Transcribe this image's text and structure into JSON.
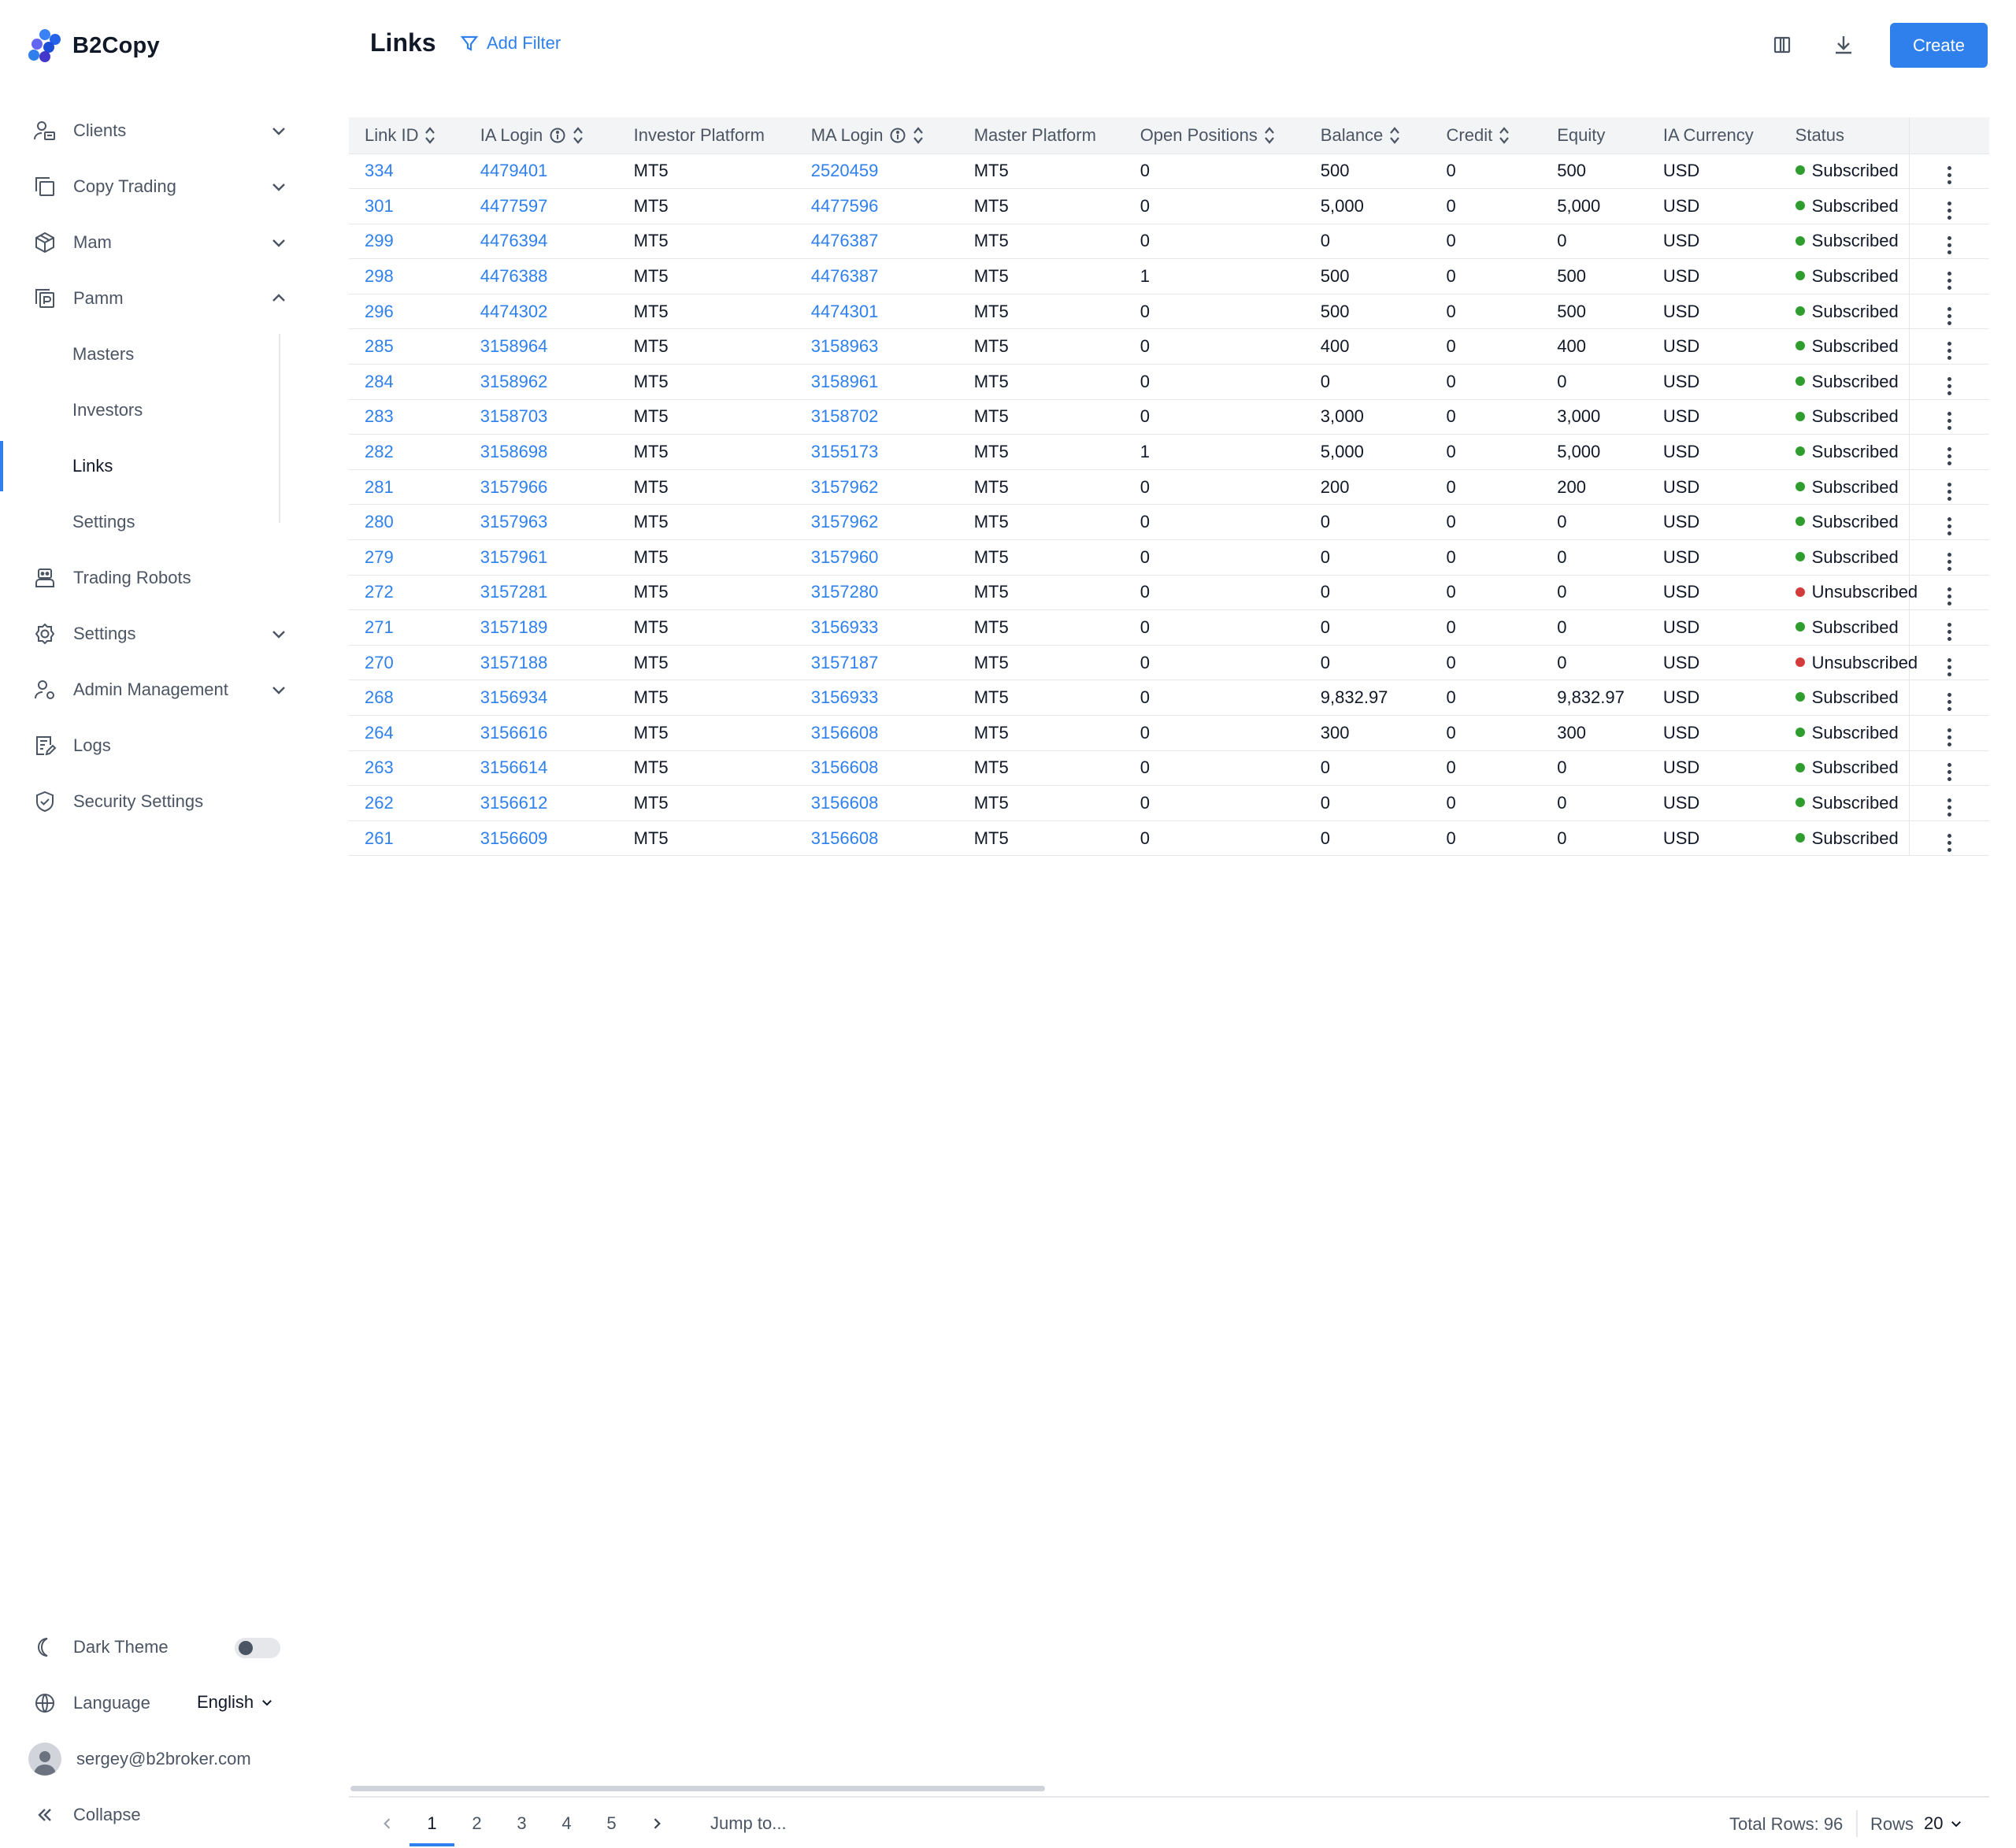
{
  "brand": {
    "name": "B2Copy"
  },
  "colors": {
    "accent": "#2f80ed",
    "subscribed": "#2e9d2e",
    "unsubscribed": "#d33b3b"
  },
  "sidebar": {
    "items": [
      {
        "label": "Clients",
        "icon": "users-icon",
        "expandable": true,
        "expanded": false
      },
      {
        "label": "Copy Trading",
        "icon": "copy-icon",
        "expandable": true,
        "expanded": false
      },
      {
        "label": "Mam",
        "icon": "cube-icon",
        "expandable": true,
        "expanded": false
      },
      {
        "label": "Pamm",
        "icon": "pamm-icon",
        "expandable": true,
        "expanded": true
      },
      {
        "label": "Trading Robots",
        "icon": "robot-icon",
        "expandable": false
      },
      {
        "label": "Settings",
        "icon": "gear-icon",
        "expandable": true,
        "expanded": false
      },
      {
        "label": "Admin Management",
        "icon": "admin-icon",
        "expandable": true,
        "expanded": false
      },
      {
        "label": "Logs",
        "icon": "logs-icon",
        "expandable": false
      },
      {
        "label": "Security Settings",
        "icon": "shield-icon",
        "expandable": false
      }
    ],
    "pamm_sub": [
      "Masters",
      "Investors",
      "Links",
      "Settings"
    ],
    "pamm_active": "Links",
    "bottom": {
      "dark_theme": "Dark Theme",
      "language_label": "Language",
      "language_value": "English",
      "user_email": "sergey@b2broker.com",
      "collapse": "Collapse"
    }
  },
  "header": {
    "title": "Links",
    "add_filter": "Add Filter",
    "create": "Create"
  },
  "table": {
    "columns": [
      "Link ID",
      "IA Login",
      "Investor Platform",
      "MA Login",
      "Master Platform",
      "Open Positions",
      "Balance",
      "Credit",
      "Equity",
      "IA Currency",
      "Status"
    ],
    "rows": [
      [
        "334",
        "4479401",
        "MT5",
        "2520459",
        "MT5",
        "0",
        "500",
        "0",
        "500",
        "USD",
        "Subscribed"
      ],
      [
        "301",
        "4477597",
        "MT5",
        "4477596",
        "MT5",
        "0",
        "5,000",
        "0",
        "5,000",
        "USD",
        "Subscribed"
      ],
      [
        "299",
        "4476394",
        "MT5",
        "4476387",
        "MT5",
        "0",
        "0",
        "0",
        "0",
        "USD",
        "Subscribed"
      ],
      [
        "298",
        "4476388",
        "MT5",
        "4476387",
        "MT5",
        "1",
        "500",
        "0",
        "500",
        "USD",
        "Subscribed"
      ],
      [
        "296",
        "4474302",
        "MT5",
        "4474301",
        "MT5",
        "0",
        "500",
        "0",
        "500",
        "USD",
        "Subscribed"
      ],
      [
        "285",
        "3158964",
        "MT5",
        "3158963",
        "MT5",
        "0",
        "400",
        "0",
        "400",
        "USD",
        "Subscribed"
      ],
      [
        "284",
        "3158962",
        "MT5",
        "3158961",
        "MT5",
        "0",
        "0",
        "0",
        "0",
        "USD",
        "Subscribed"
      ],
      [
        "283",
        "3158703",
        "MT5",
        "3158702",
        "MT5",
        "0",
        "3,000",
        "0",
        "3,000",
        "USD",
        "Subscribed"
      ],
      [
        "282",
        "3158698",
        "MT5",
        "3155173",
        "MT5",
        "1",
        "5,000",
        "0",
        "5,000",
        "USD",
        "Subscribed"
      ],
      [
        "281",
        "3157966",
        "MT5",
        "3157962",
        "MT5",
        "0",
        "200",
        "0",
        "200",
        "USD",
        "Subscribed"
      ],
      [
        "280",
        "3157963",
        "MT5",
        "3157962",
        "MT5",
        "0",
        "0",
        "0",
        "0",
        "USD",
        "Subscribed"
      ],
      [
        "279",
        "3157961",
        "MT5",
        "3157960",
        "MT5",
        "0",
        "0",
        "0",
        "0",
        "USD",
        "Subscribed"
      ],
      [
        "272",
        "3157281",
        "MT5",
        "3157280",
        "MT5",
        "0",
        "0",
        "0",
        "0",
        "USD",
        "Unsubscribed"
      ],
      [
        "271",
        "3157189",
        "MT5",
        "3156933",
        "MT5",
        "0",
        "0",
        "0",
        "0",
        "USD",
        "Subscribed"
      ],
      [
        "270",
        "3157188",
        "MT5",
        "3157187",
        "MT5",
        "0",
        "0",
        "0",
        "0",
        "USD",
        "Unsubscribed"
      ],
      [
        "268",
        "3156934",
        "MT5",
        "3156933",
        "MT5",
        "0",
        "9,832.97",
        "0",
        "9,832.97",
        "USD",
        "Subscribed"
      ],
      [
        "264",
        "3156616",
        "MT5",
        "3156608",
        "MT5",
        "0",
        "300",
        "0",
        "300",
        "USD",
        "Subscribed"
      ],
      [
        "263",
        "3156614",
        "MT5",
        "3156608",
        "MT5",
        "0",
        "0",
        "0",
        "0",
        "USD",
        "Subscribed"
      ],
      [
        "262",
        "3156612",
        "MT5",
        "3156608",
        "MT5",
        "0",
        "0",
        "0",
        "0",
        "USD",
        "Subscribed"
      ],
      [
        "261",
        "3156609",
        "MT5",
        "3156608",
        "MT5",
        "0",
        "0",
        "0",
        "0",
        "USD",
        "Subscribed"
      ]
    ]
  },
  "pagination": {
    "pages": [
      "1",
      "2",
      "3",
      "4",
      "5"
    ],
    "current": "1",
    "jump_to": "Jump to...",
    "total_rows": "Total Rows: 96",
    "rows_label": "Rows",
    "rows_value": "20"
  }
}
